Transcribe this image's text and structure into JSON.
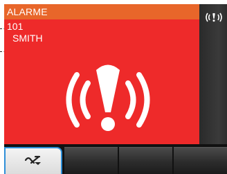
{
  "alert": {
    "title": "ALARME",
    "number": "101",
    "name": "SMITH"
  },
  "icons": {
    "alarm": "alarm-exclamation-icon",
    "side": "alarm-status-icon",
    "softkey": "mute-alarm-icon"
  },
  "colors": {
    "header": "#e8662a",
    "body": "#ee2a2a",
    "highlight": "#2e8fd8"
  }
}
